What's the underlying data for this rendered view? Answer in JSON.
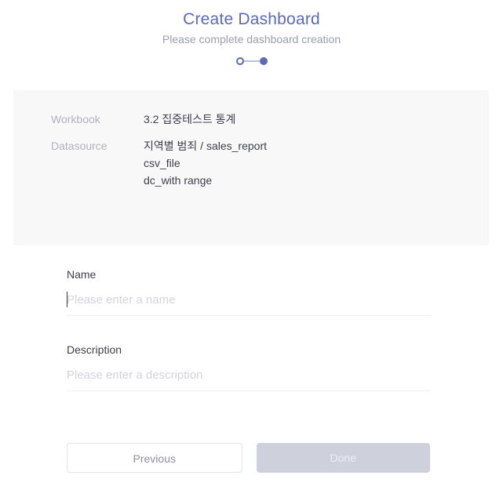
{
  "header": {
    "title": "Create Dashboard",
    "subtitle": "Please complete dashboard creation"
  },
  "stepper": {
    "steps": [
      {
        "name": "step-1",
        "state": "done"
      },
      {
        "name": "step-2",
        "state": "active"
      }
    ]
  },
  "summary": {
    "workbook_label": "Workbook",
    "workbook_value": "3.2 집중테스트 통계",
    "datasource_label": "Datasource",
    "datasource_value": "지역별 범죄 / sales_report\ncsv_file\ndc_with range"
  },
  "form": {
    "name_label": "Name",
    "name_value": "",
    "name_placeholder": "Please enter a name",
    "description_label": "Description",
    "description_value": "",
    "description_placeholder": "Please enter a description"
  },
  "footer": {
    "previous_label": "Previous",
    "done_label": "Done"
  },
  "colors": {
    "accent": "#5b6ab8",
    "panel_bg": "#f8f8f9",
    "muted_text": "#b2b2bd",
    "subtitle": "#9c9cab",
    "placeholder": "#d3d3dd",
    "done_button_bg": "#ced0dc",
    "underline": "#eeeef1"
  }
}
